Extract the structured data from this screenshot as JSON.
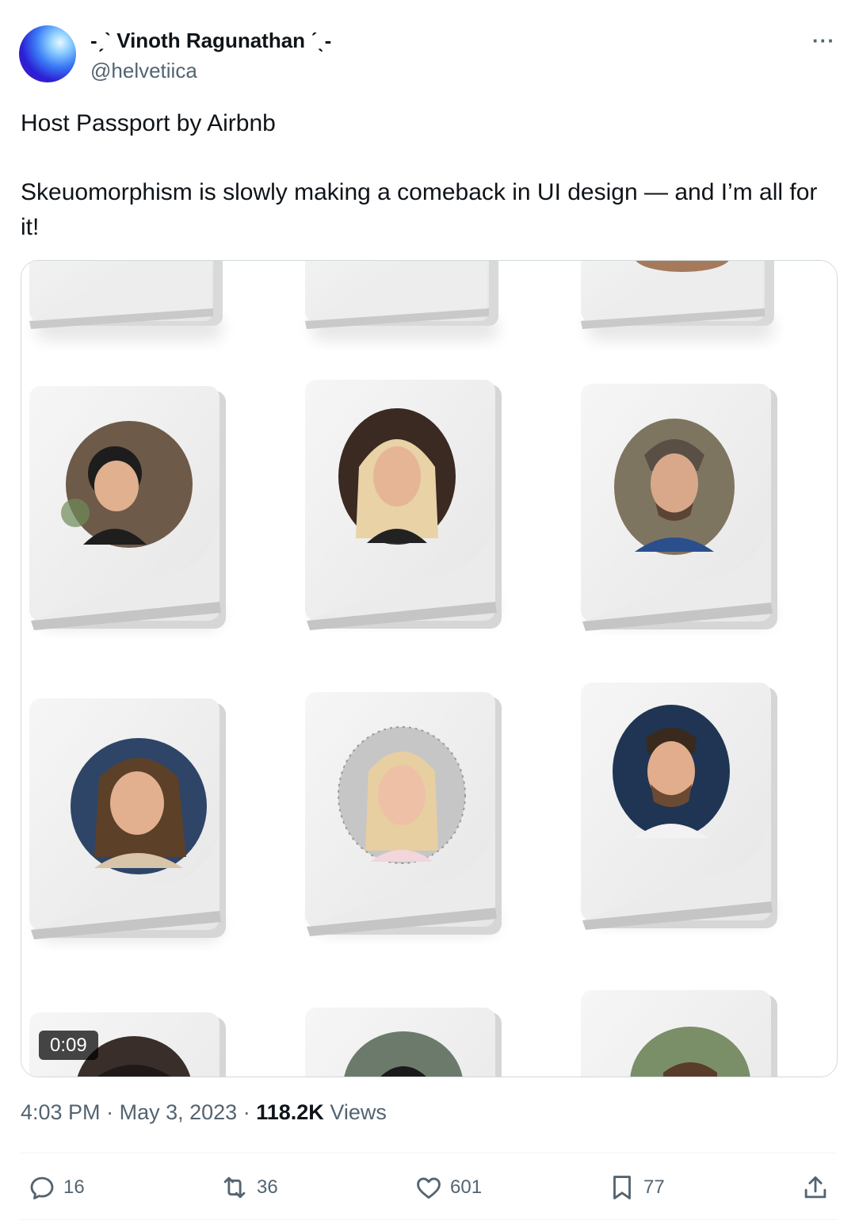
{
  "tweet": {
    "author_name": "-ˏˋ Vinoth Ragunathan ˊˎ-",
    "author_handle": "@helvetiica",
    "more_label": "···",
    "text_line_1": "Host Passport by Airbnb",
    "text_line_2": "Skeuomorphism is slowly making a comeback in UI design — and I’m all for it!",
    "media": {
      "duration": "0:09"
    },
    "meta": {
      "time": "4:03 PM",
      "separator": "·",
      "date": "May 3, 2023",
      "views_count": "118.2K",
      "views_label": "Views"
    },
    "actions": {
      "replies": "16",
      "reposts": "36",
      "likes": "601",
      "bookmarks": "77"
    }
  },
  "icons": {
    "avatar": "gradient-orb",
    "more": "more-horizontal-icon",
    "reply": "reply-icon",
    "repost": "repost-icon",
    "like": "heart-icon",
    "bookmark": "bookmark-icon",
    "share": "share-icon"
  }
}
